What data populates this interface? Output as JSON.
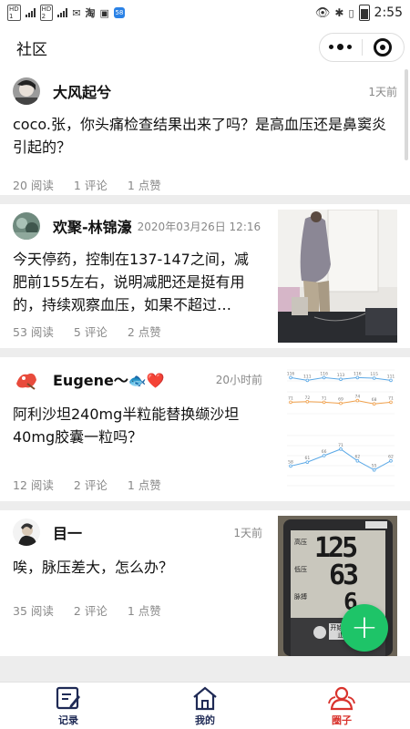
{
  "status_bar": {
    "time": "2:55",
    "left_icons": [
      "hd-signal-icon",
      "hd-signal-icon",
      "message-icon",
      "taobao-icon",
      "app-icon"
    ],
    "right_icons": [
      "eye-icon",
      "bluetooth-icon",
      "vibrate-icon",
      "battery-icon"
    ]
  },
  "header": {
    "title": "社区"
  },
  "posts": [
    {
      "author": "大风起兮",
      "time": "1天前",
      "text": "coco.张，你头痛检查结果出来了吗？是高血压还是鼻窦炎引起的？",
      "reads": "20 阅读",
      "comments": "1 评论",
      "likes": "1 点赞",
      "has_image": false
    },
    {
      "author": "欢聚-林锦濠",
      "time": "2020年03月26日 12:16",
      "text": "今天停药，控制在137-147之间，减肥前155左右，说明减肥还是挺有用的，持续观察血压，如果不超过…",
      "reads": "53 阅读",
      "comments": "5 评论",
      "likes": "2 点赞",
      "has_image": true
    },
    {
      "author": "Eugene～🐟❤️",
      "time": "20小时前",
      "text": "阿利沙坦240mg半粒能替换缬沙坦40mg胶囊一粒吗？",
      "reads": "12 阅读",
      "comments": "2 评论",
      "likes": "1 点赞",
      "has_image": true
    },
    {
      "author": "目一",
      "time": "1天前",
      "text": "唉，脉压差大，怎么办？",
      "reads": "35 阅读",
      "comments": "2 评论",
      "likes": "1 点赞",
      "has_image": true
    }
  ],
  "bp_chart": {
    "systolic": [
      "116",
      "111",
      "116",
      "113",
      "116",
      "115",
      "111"
    ],
    "diastolic": [
      "71",
      "72",
      "71",
      "69",
      "74",
      "68",
      "71"
    ],
    "heart_rate": [
      "58",
      "61",
      "66",
      "71",
      "62",
      "55",
      "62"
    ]
  },
  "monitor": {
    "labels": [
      "高压",
      "低压",
      "脉搏"
    ],
    "sys": "125",
    "dia": "63",
    "pulse": "6",
    "button": "开始 停止"
  },
  "fab": {
    "label": "+"
  },
  "tabs": [
    {
      "label": "记录",
      "icon": "edit-note-icon",
      "color": "#1f2a55"
    },
    {
      "label": "我的",
      "icon": "home-icon",
      "color": "#1f2a55"
    },
    {
      "label": "圈子",
      "icon": "group-icon",
      "color": "#d9332d"
    }
  ]
}
